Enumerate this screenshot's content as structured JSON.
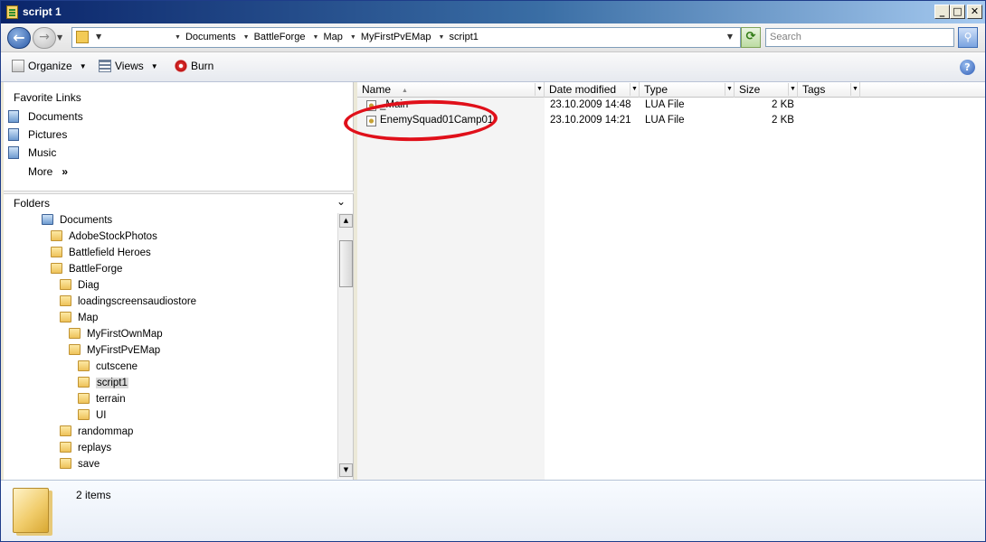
{
  "window": {
    "title": "script 1"
  },
  "address": {
    "crumbs": [
      "Documents",
      "BattleForge",
      "Map",
      "MyFirstPvEMap",
      "script1"
    ],
    "search_placeholder": "Search"
  },
  "toolbar": {
    "organize": "Organize",
    "views": "Views",
    "burn": "Burn"
  },
  "favorites": {
    "title": "Favorite Links",
    "items": [
      "Documents",
      "Pictures",
      "Music"
    ],
    "more": "More"
  },
  "folders": {
    "title": "Folders",
    "tree": [
      {
        "label": "Documents",
        "level": 0,
        "selected": false,
        "icon": "documents-icon"
      },
      {
        "label": "AdobeStockPhotos",
        "level": 1,
        "selected": false,
        "icon": "folder-icon"
      },
      {
        "label": "Battlefield Heroes",
        "level": 1,
        "selected": false,
        "icon": "folder-icon"
      },
      {
        "label": "BattleForge",
        "level": 1,
        "selected": false,
        "icon": "folder-icon"
      },
      {
        "label": "Diag",
        "level": 2,
        "selected": false,
        "icon": "folder-icon"
      },
      {
        "label": "loadingscreensaudiostore",
        "level": 2,
        "selected": false,
        "icon": "folder-icon"
      },
      {
        "label": "Map",
        "level": 2,
        "selected": false,
        "icon": "folder-icon"
      },
      {
        "label": "MyFirstOwnMap",
        "level": 3,
        "selected": false,
        "icon": "folder-icon"
      },
      {
        "label": "MyFirstPvEMap",
        "level": 3,
        "selected": false,
        "icon": "folder-icon"
      },
      {
        "label": "cutscene",
        "level": 4,
        "selected": false,
        "icon": "folder-icon"
      },
      {
        "label": "script1",
        "level": 4,
        "selected": true,
        "icon": "folder-icon"
      },
      {
        "label": "terrain",
        "level": 4,
        "selected": false,
        "icon": "folder-icon"
      },
      {
        "label": "UI",
        "level": 4,
        "selected": false,
        "icon": "folder-icon"
      },
      {
        "label": "randommap",
        "level": 2,
        "selected": false,
        "icon": "folder-icon"
      },
      {
        "label": "replays",
        "level": 2,
        "selected": false,
        "icon": "folder-icon"
      },
      {
        "label": "save",
        "level": 2,
        "selected": false,
        "icon": "folder-icon"
      }
    ]
  },
  "columns": [
    "Name",
    "Date modified",
    "Type",
    "Size",
    "Tags"
  ],
  "files": [
    {
      "name": "_Main",
      "date": "23.10.2009 14:48",
      "type": "LUA File",
      "size": "2 KB"
    },
    {
      "name": "EnemySquad01Camp01",
      "date": "23.10.2009 14:21",
      "type": "LUA File",
      "size": "2 KB"
    }
  ],
  "status": {
    "count": "2 items"
  },
  "colors": {
    "annotation": "#e0101a",
    "titlebar": "#0a246a"
  }
}
